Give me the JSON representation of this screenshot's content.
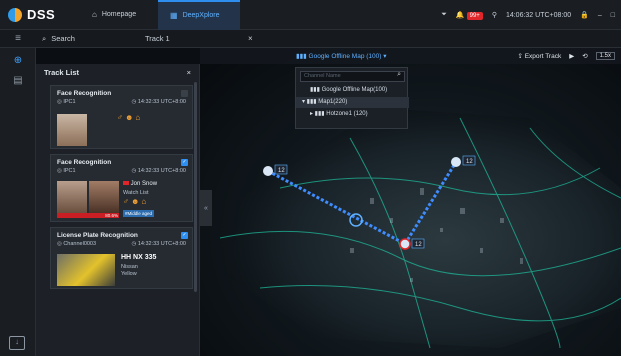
{
  "app": {
    "name": "DSS"
  },
  "topbar": {
    "tabs": [
      {
        "label": "Homepage",
        "icon": "home-icon"
      },
      {
        "label": "DeepXplore",
        "icon": "grid-icon"
      }
    ],
    "alarm_count": "99+",
    "time": "14:06:32 UTC+08:00"
  },
  "toolbar": {
    "search_label": "Search",
    "track_tab_label": "Track 1"
  },
  "track_list": {
    "title": "Track List",
    "cards": [
      {
        "title": "Face Recognition",
        "camera": "IPC1",
        "time": "14:32:33 UTC+8:00"
      },
      {
        "title": "Face Recognition",
        "camera": "IPC1",
        "time": "14:32:33 UTC+8:00",
        "name": "Jon Snow",
        "list": "Watch List",
        "score": "80.6%",
        "attribute": "#Middle aged"
      },
      {
        "title": "License Plate Recognition",
        "camera": "Channel0003",
        "time": "14:32:33 UTC+8:00",
        "plate": "HH NX 335",
        "brand": "Nissan",
        "color": "Yellow"
      }
    ]
  },
  "map": {
    "selected_map": "Google Offline Map (100)",
    "export_label": "Export Track",
    "speed": "1.5x",
    "dropdown": {
      "placeholder": "Channel Name",
      "items": [
        "Google Offline Map(100)",
        "Map1(220)",
        "Hotzone1 (120)"
      ]
    },
    "markers": [
      "12",
      "12",
      "12"
    ]
  }
}
